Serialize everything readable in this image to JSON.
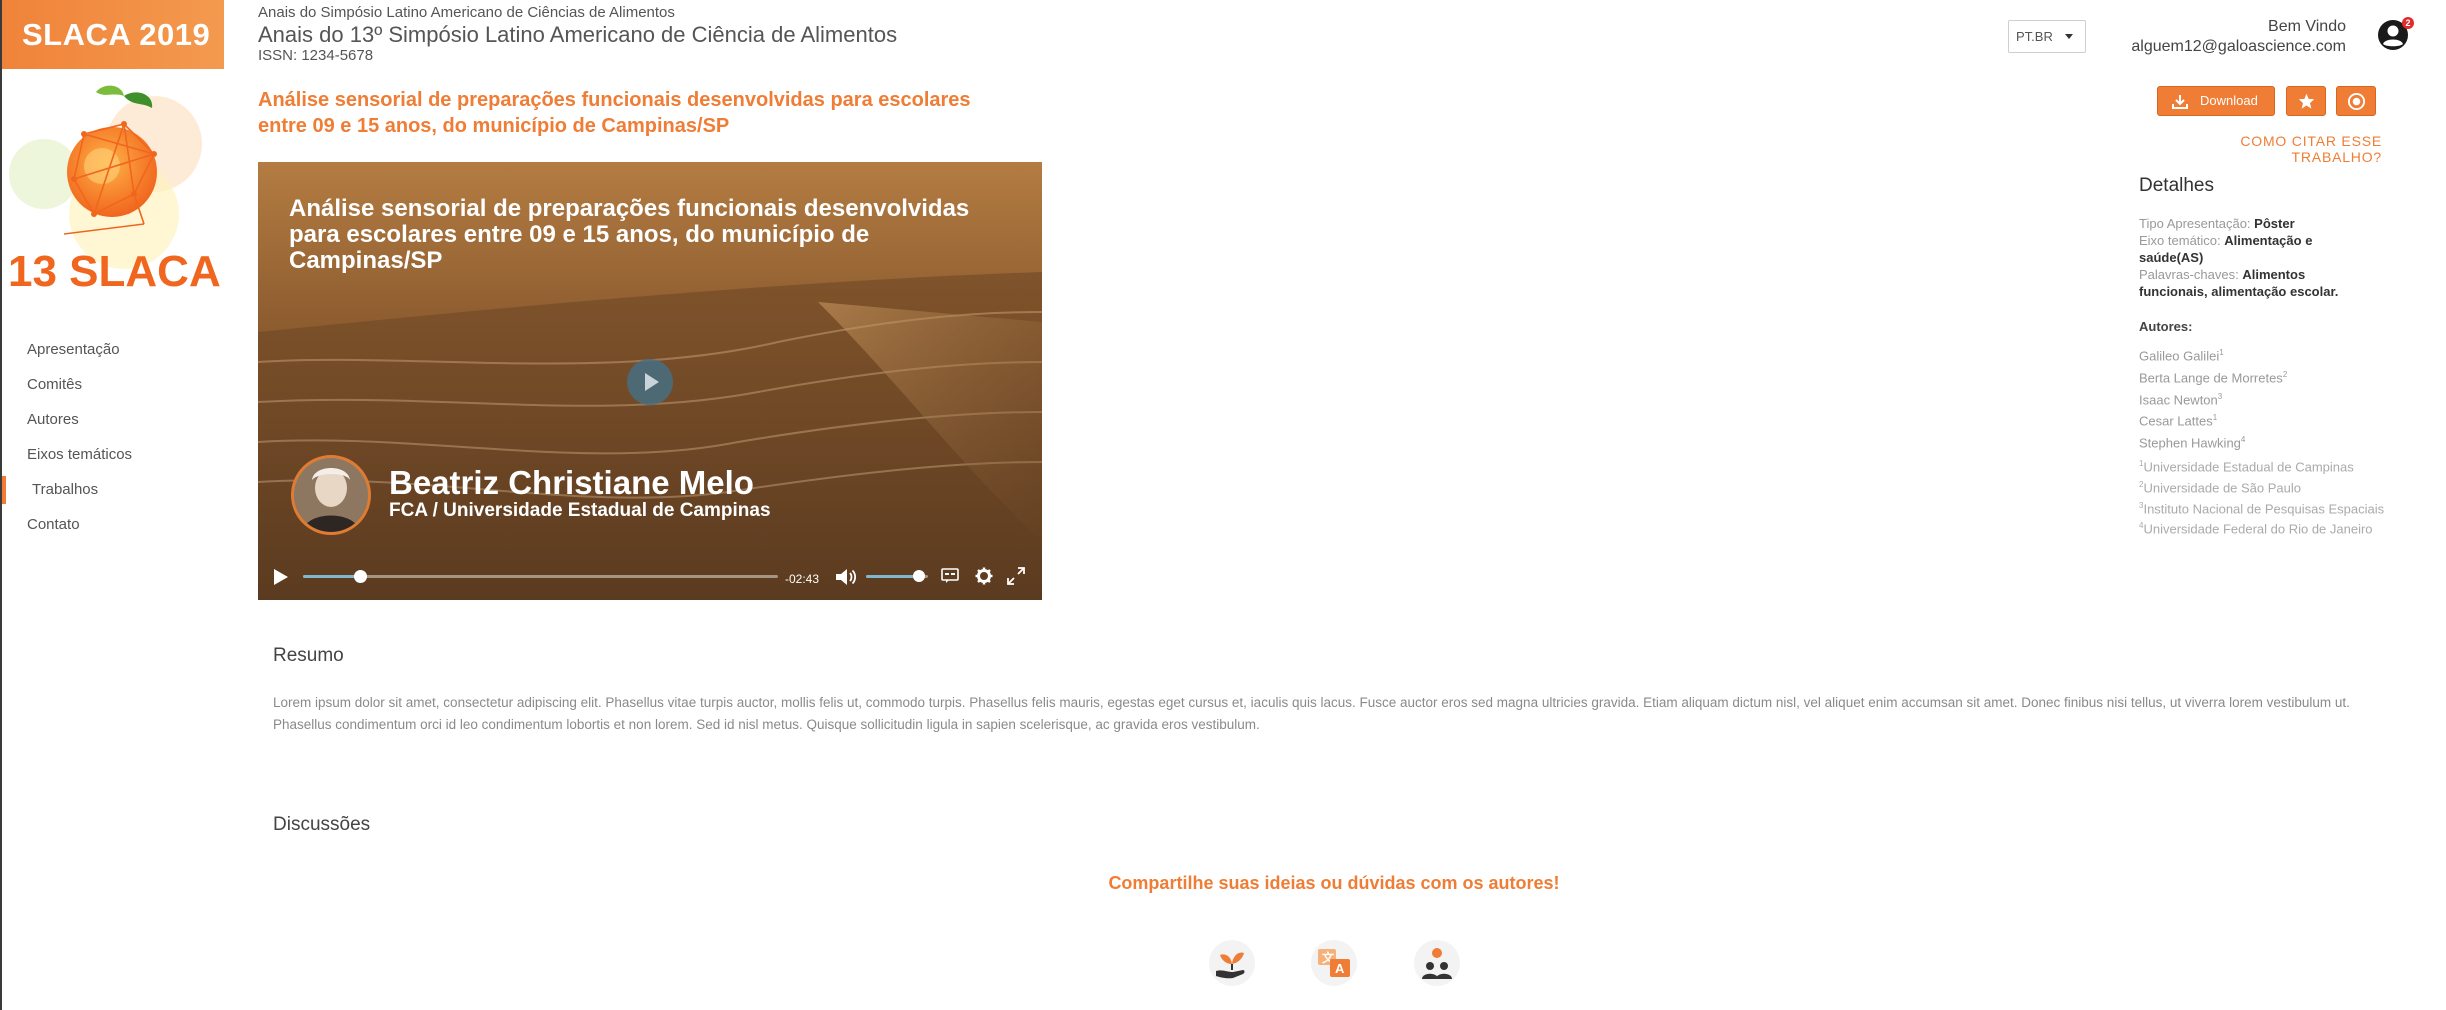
{
  "sidebar": {
    "brand": "SLACA 2019",
    "logo_text": "13 SLACA",
    "items": [
      {
        "label": "Apresentação",
        "active": false
      },
      {
        "label": "Comitês",
        "active": false
      },
      {
        "label": "Autores",
        "active": false
      },
      {
        "label": "Eixos temáticos",
        "active": false
      },
      {
        "label": "Trabalhos",
        "active": true
      },
      {
        "label": "Contato",
        "active": false
      }
    ]
  },
  "header": {
    "subtitle": "Anais do Simpósio Latino Americano de Ciências de Alimentos",
    "title": "Anais do 13º Simpósio Latino Americano de Ciência de Alimentos",
    "issn": "ISSN: 1234-5678",
    "language": "PT.BR",
    "welcome": "Bem Vindo",
    "email": "alguem12@galoascience.com",
    "notification_count": "2"
  },
  "paper": {
    "title": "Análise sensorial de preparações funcionais desenvolvidas para escolares entre 09 e 15 anos, do município de Campinas/SP"
  },
  "video": {
    "title": "Análise sensorial de preparações funcionais desenvolvidas para escolares entre 09 e 15 anos, do município de Campinas/SP",
    "presenter_name": "Beatriz Christiane Melo",
    "presenter_institution": "FCA / Universidade Estadual de Campinas",
    "time_remaining": "-02:43",
    "progress": 0.12,
    "volume": 0.85
  },
  "actions": {
    "download_label": "Download",
    "cite_label": "COMO CITAR ESSE TRABALHO?"
  },
  "details": {
    "heading": "Detalhes",
    "presentation_type_label": "Tipo Apresentação:",
    "presentation_type": "Pôster",
    "theme_label": "Eixo temático:",
    "theme": "Alimentação e saúde(AS)",
    "keywords_label": "Palavras-chaves:",
    "keywords": "Alimentos funcionais, alimentação escolar.",
    "authors_heading": "Autores:",
    "authors": [
      {
        "name": "Galileo Galilei",
        "sup": "1"
      },
      {
        "name": "Berta Lange de Morretes",
        "sup": "2"
      },
      {
        "name": "Isaac Newton",
        "sup": "3"
      },
      {
        "name": "Cesar Lattes",
        "sup": "1"
      },
      {
        "name": "Stephen Hawking",
        "sup": "4"
      }
    ],
    "affiliations": [
      {
        "sup": "1",
        "name": "Universidade Estadual de Campinas"
      },
      {
        "sup": "2",
        "name": "Universidade de São Paulo"
      },
      {
        "sup": "3",
        "name": "Instituto Nacional de Pesquisas Espaciais"
      },
      {
        "sup": "4",
        "name": "Universidade Federal do Rio de Janeiro"
      }
    ]
  },
  "abstract": {
    "heading": "Resumo",
    "text": "Lorem ipsum dolor sit amet, consectetur adipiscing elit. Phasellus vitae turpis auctor, mollis felis ut, commodo turpis. Phasellus felis mauris, egestas eget cursus et, iaculis quis lacus. Fusce auctor eros sed magna ultricies gravida. Etiam aliquam dictum nisl, vel aliquet enim accumsan sit amet. Donec finibus nisi tellus, ut viverra lorem vestibulum ut. Phasellus condimentum orci id leo condimentum lobortis et non lorem. Sed id nisl metus. Quisque sollicitudin ligula in sapien scelerisque, ac gravida eros vestibulum."
  },
  "discussion": {
    "heading": "Discussões",
    "prompt": "Compartilhe suas ideias ou dúvidas com os autores!",
    "icons": [
      "plant-hand-icon",
      "translate-icon",
      "people-icon"
    ]
  },
  "colors": {
    "accent": "#ef7d35",
    "notification": "#e22a2a"
  }
}
